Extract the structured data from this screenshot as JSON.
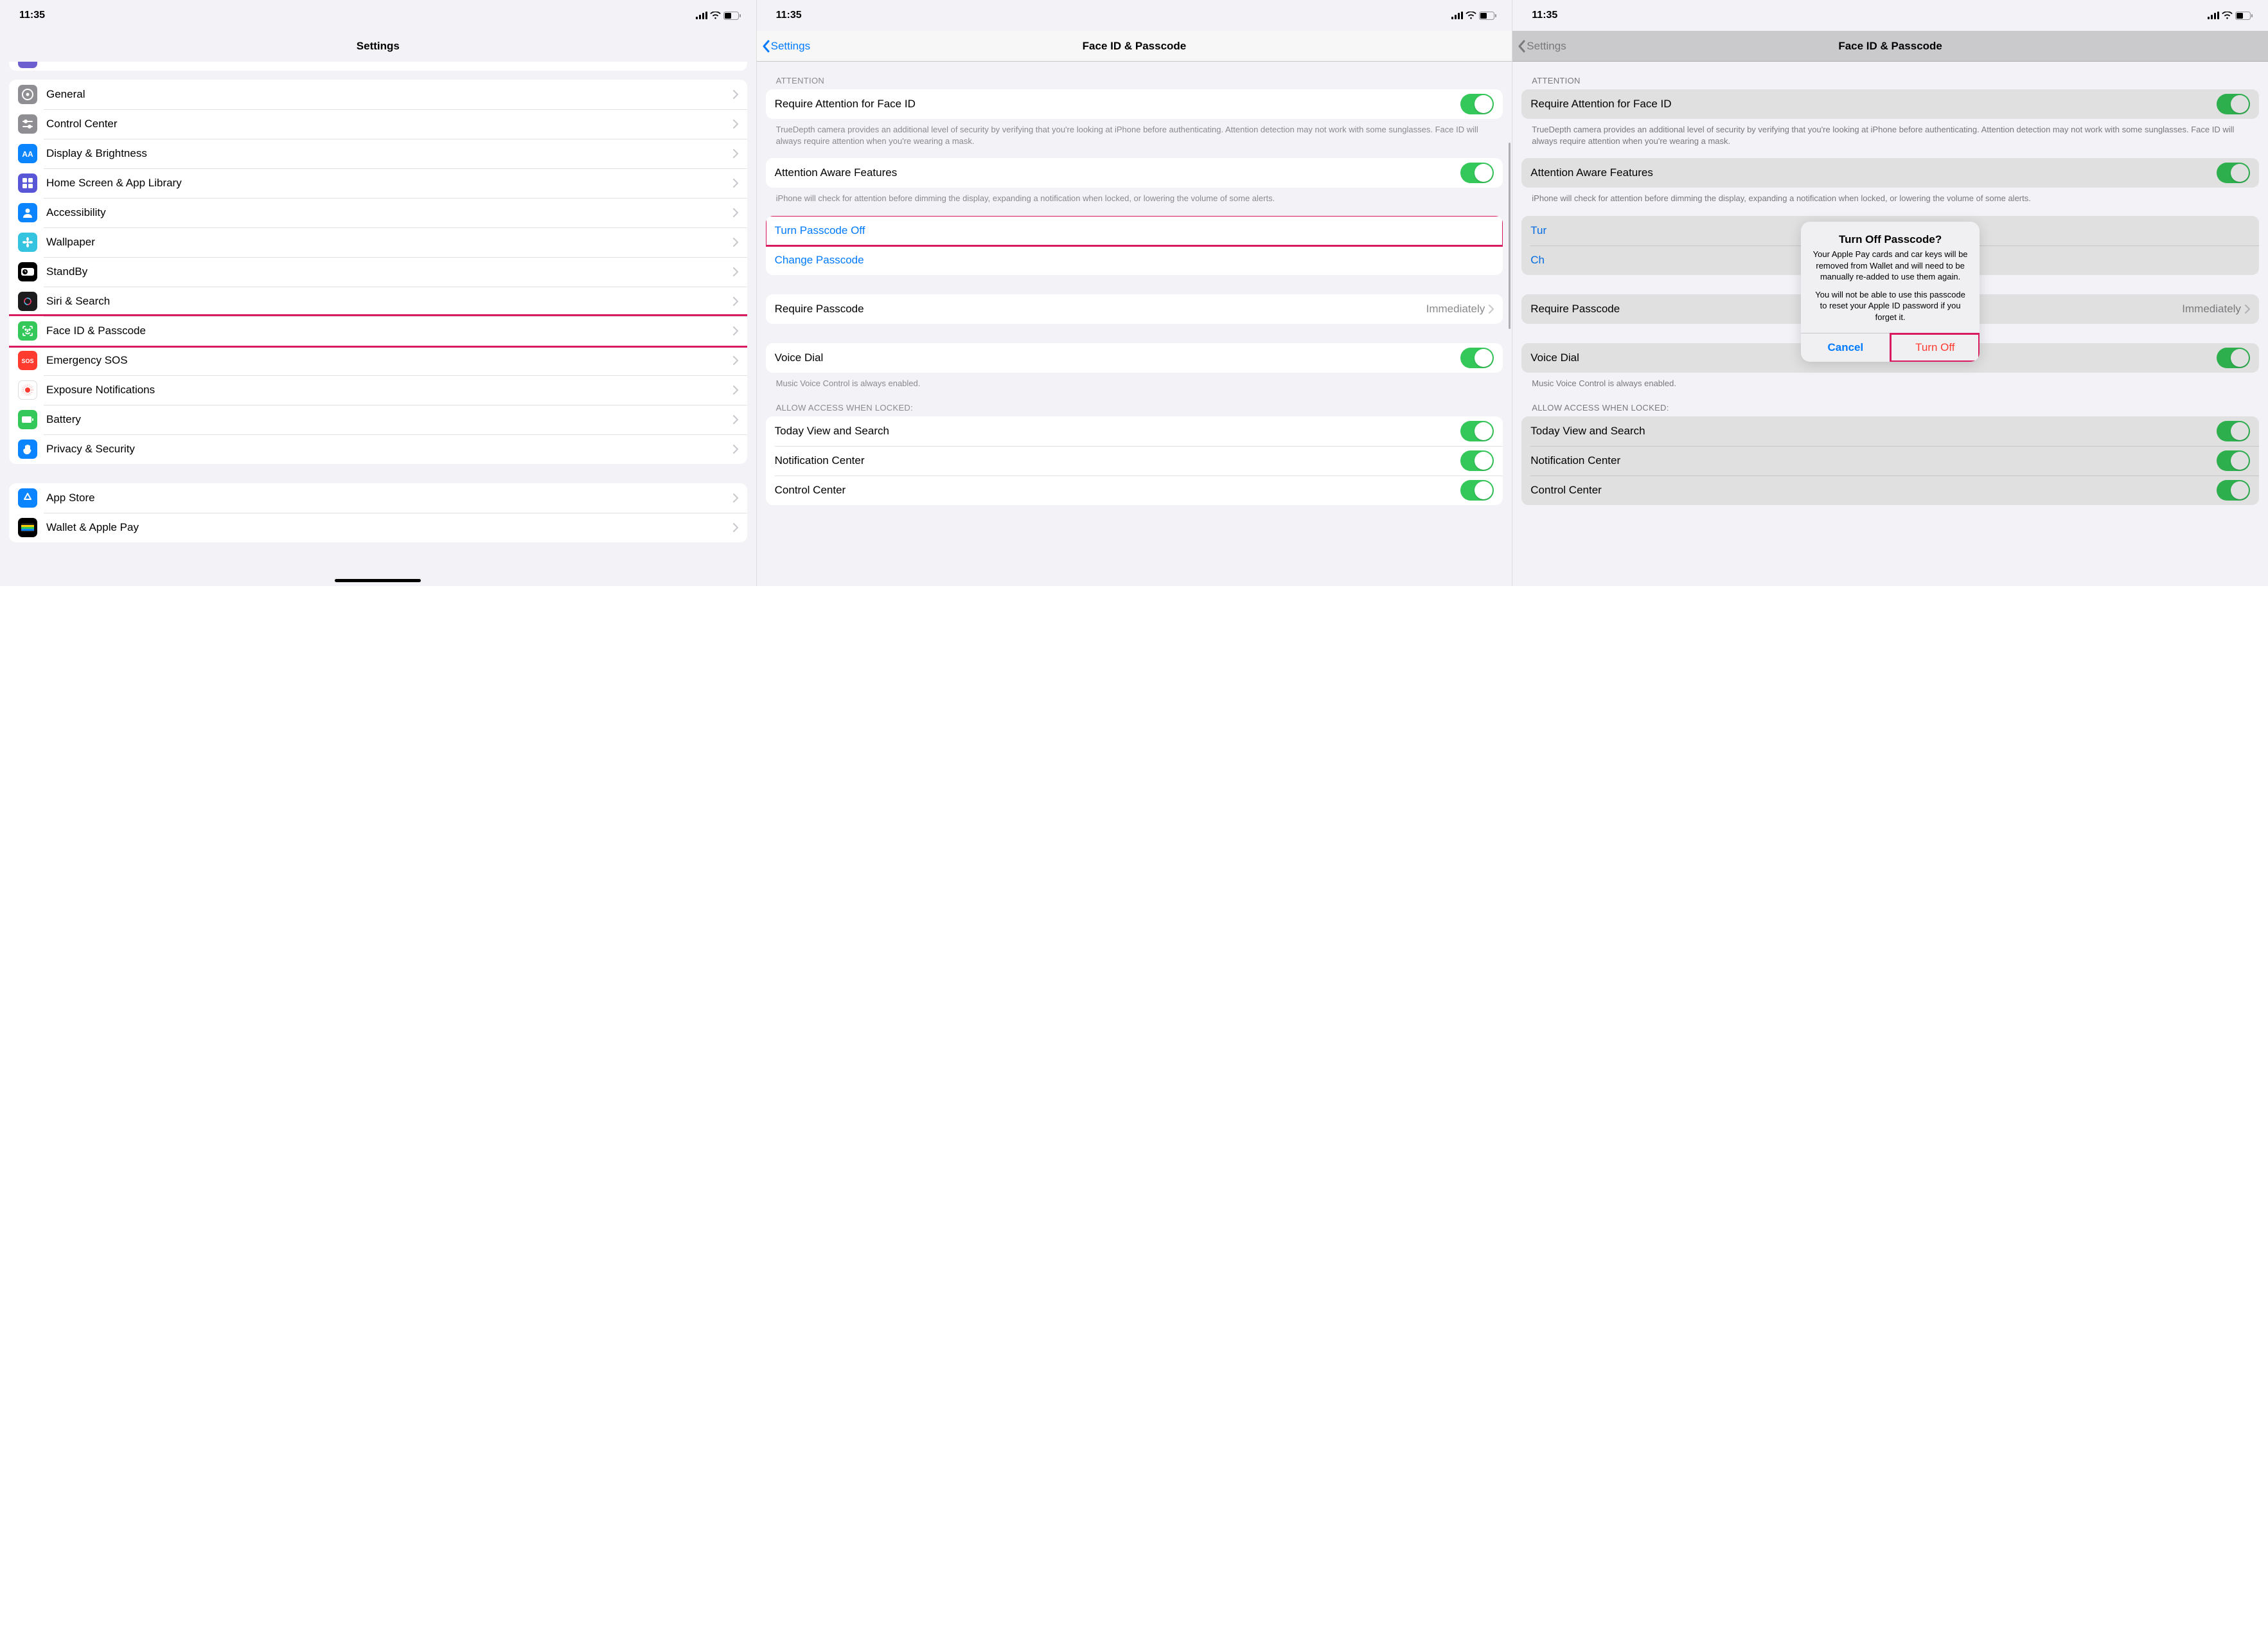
{
  "time": "11:35",
  "panel1": {
    "title": "Settings",
    "items": [
      {
        "name": "General",
        "icon": "gear",
        "color": "#8e8e93",
        "key": "general"
      },
      {
        "name": "Control Center",
        "icon": "sliders",
        "color": "#8e8e93",
        "key": "control-center"
      },
      {
        "name": "Display & Brightness",
        "icon": "sun",
        "color": "#0a84ff",
        "key": "display-brightness"
      },
      {
        "name": "Home Screen & App Library",
        "icon": "grid",
        "color": "#5856d6",
        "key": "home-screen"
      },
      {
        "name": "Accessibility",
        "icon": "person",
        "color": "#0a84ff",
        "key": "accessibility"
      },
      {
        "name": "Wallpaper",
        "icon": "flower",
        "color": "#34c4e0",
        "key": "wallpaper"
      },
      {
        "name": "StandBy",
        "icon": "clock",
        "color": "#000000",
        "key": "standby"
      },
      {
        "name": "Siri & Search",
        "icon": "siri",
        "color": "#1c1c1e",
        "key": "siri-search"
      },
      {
        "name": "Face ID & Passcode",
        "icon": "faceid",
        "color": "#34c759",
        "key": "faceid-passcode",
        "highlight": true
      },
      {
        "name": "Emergency SOS",
        "icon": "sos",
        "color": "#ff3b30",
        "key": "emergency-sos"
      },
      {
        "name": "Exposure Notifications",
        "icon": "exposure",
        "color": "#ffffff",
        "key": "exposure"
      },
      {
        "name": "Battery",
        "icon": "battery",
        "color": "#34c759",
        "key": "battery"
      },
      {
        "name": "Privacy & Security",
        "icon": "hand",
        "color": "#0a84ff",
        "key": "privacy"
      }
    ],
    "store_items": [
      {
        "name": "App Store",
        "icon": "appstore",
        "color": "#0a84ff",
        "key": "app-store"
      },
      {
        "name": "Wallet & Apple Pay",
        "icon": "wallet",
        "color": "#000000",
        "key": "wallet"
      }
    ]
  },
  "panel2": {
    "back": "Settings",
    "title": "Face ID & Passcode",
    "section_attention": "ATTENTION",
    "require_attention": "Require Attention for Face ID",
    "require_attention_footer": "TrueDepth camera provides an additional level of security by verifying that you're looking at iPhone before authenticating. Attention detection may not work with some sunglasses. Face ID will always require attention when you're wearing a mask.",
    "attention_aware": "Attention Aware Features",
    "attention_aware_footer": "iPhone will check for attention before dimming the display, expanding a notification when locked, or lowering the volume of some alerts.",
    "turn_off": "Turn Passcode Off",
    "change": "Change Passcode",
    "require_passcode": "Require Passcode",
    "require_passcode_value": "Immediately",
    "voice_dial": "Voice Dial",
    "voice_dial_footer": "Music Voice Control is always enabled.",
    "allow_access": "ALLOW ACCESS WHEN LOCKED:",
    "today_view": "Today View and Search",
    "notification_center": "Notification Center",
    "control_center": "Control Center"
  },
  "panel3": {
    "back": "Settings",
    "title": "Face ID & Passcode",
    "turn_off_short": "Tur",
    "change_short": "Ch",
    "alert": {
      "title": "Turn Off Passcode?",
      "text1": "Your Apple Pay cards and car keys will be removed from Wallet and will need to be manually re-added to use them again.",
      "text2": "You will not be able to use this passcode to reset your Apple ID password if you forget it.",
      "cancel": "Cancel",
      "confirm": "Turn Off"
    }
  }
}
